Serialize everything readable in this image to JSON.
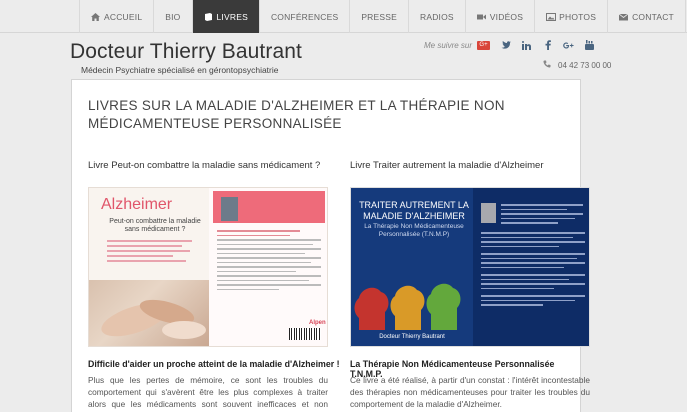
{
  "nav": {
    "items": [
      {
        "label": "ACCUEIL",
        "icon": "home-icon",
        "active": false
      },
      {
        "label": "BIO",
        "icon": "",
        "active": false
      },
      {
        "label": "LIVRES",
        "icon": "book-icon",
        "active": true
      },
      {
        "label": "CONFÉRENCES",
        "icon": "",
        "active": false
      },
      {
        "label": "PRESSE",
        "icon": "",
        "active": false
      },
      {
        "label": "RADIOS",
        "icon": "",
        "active": false
      },
      {
        "label": "VIDÉOS",
        "icon": "video-icon",
        "active": false
      },
      {
        "label": "PHOTOS",
        "icon": "photo-icon",
        "active": false
      },
      {
        "label": "CONTACT",
        "icon": "envelope-icon",
        "active": false
      }
    ]
  },
  "header": {
    "title": "Docteur Thierry Bautrant",
    "subtitle": "Médecin Psychiatre spécialisé en gérontopsychiatrie",
    "follow_label": "Me suivre sur",
    "gplus_badge": "G+",
    "social_icons": [
      "google-plus-icon",
      "twitter-icon",
      "linkedin-icon",
      "facebook-icon",
      "google-plus-icon",
      "youtube-icon"
    ],
    "phone": "04 42 73 00 00"
  },
  "content": {
    "title": "LIVRES SUR LA MALADIE D'ALZHEIMER ET LA THÉRAPIE NON MÉDICAMENTEUSE PERSONNALISÉE",
    "books": [
      {
        "heading": "Livre Peut-on combattre la maladie sans médicament ?",
        "cover_title": "Alzheimer",
        "cover_subtitle": "Peut-on combattre la maladie sans médicament ?",
        "cover_brand": "Alpen",
        "caption": "Difficile d'aider un proche atteint de la maladie d'Alzheimer !",
        "text": "Plus que les pertes de mémoire, ce sont les troubles du comportement qui s'avèrent être les plus complexes à traiter alors que les médicaments sont souvent inefficaces et non dénués d'effets secondaires."
      },
      {
        "heading": "Livre Traiter autrement la maladie d'Alzheimer",
        "cover_title": "TRAITER AUTREMENT LA MALADIE D'ALZHEIMER",
        "cover_subtitle": "La Thérapie Non Médicamenteuse Personnalisée (T.N.M.P)",
        "cover_author": "Docteur Thierry Bautrant",
        "caption": "La Thérapie Non Médicamenteuse Personnalisée T.N.M.P.",
        "text": "Ce livre a été réalisé, à partir d'un constat : l'intérêt incontestable des thérapies non médicamenteuses pour traiter les troubles du comportement de la maladie d'Alzheimer."
      }
    ]
  },
  "colors": {
    "nav_active_bg": "#3a3a3a",
    "alzheimer_pink": "#e0556a",
    "book2_blue": "#153a7c",
    "gplus_red": "#d9453a"
  }
}
